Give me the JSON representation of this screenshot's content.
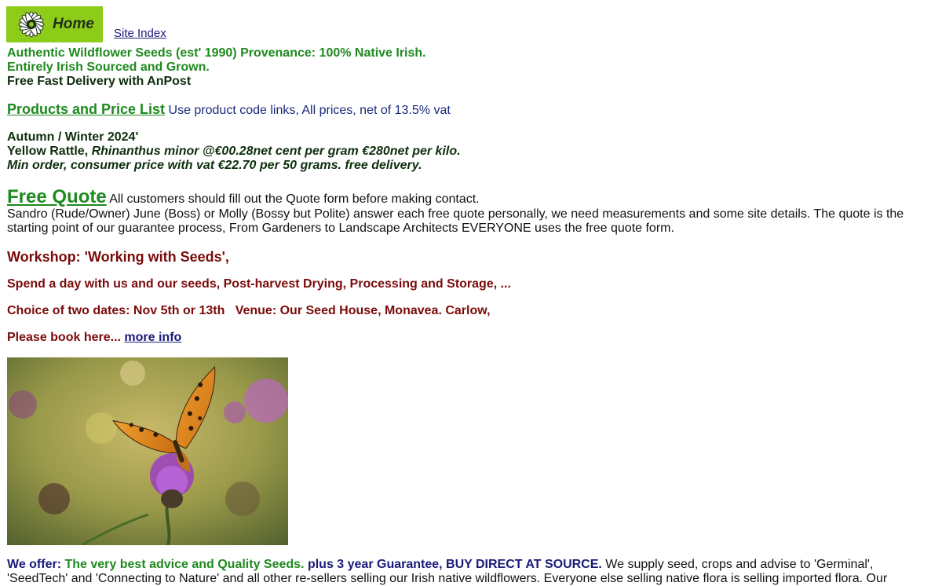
{
  "header": {
    "home_label": "Home",
    "site_index_label": "Site Index"
  },
  "intro": {
    "line1": "Authentic Wildflower Seeds (est' 1990) Provenance: 100% Native Irish.",
    "line2": "Entirely Irish Sourced and Grown.",
    "line3": "Free Fast Delivery with AnPost"
  },
  "products": {
    "link_label": "Products and Price List",
    "note": " Use product code links, All prices, net of 13.5% vat"
  },
  "offer_season": {
    "season": "Autumn / Winter 2024'",
    "item_name": "Yellow Rattle, ",
    "item_detail": "Rhinanthus minor @€00.28net cent per gram €280net per kilo.",
    "min_order": "Min order, consumer price with vat €22.70 per 50 grams. free delivery."
  },
  "quote": {
    "link_label": "Free Quote",
    "lead": " All customers should fill out the Quote form before making contact.",
    "paragraph": "Sandro (Rude/Owner) June (Boss) or Molly (Bossy but Polite) answer each free quote personally, we need measurements and some site details. The quote is the starting point of our guarantee process, From Gardeners to Landscape Architects EVERYONE uses the free quote form."
  },
  "workshop": {
    "title": "Workshop: 'Working with Seeds',",
    "line1": "Spend a day with us and our seeds, Post-harvest Drying, Processing and Storage, ...",
    "line2": "Choice of two dates: Nov 5th or 13th   Venue: Our Seed House, Monavea. Carlow,",
    "line3_text": "Please book here... ",
    "line3_link": "more info"
  },
  "offer": {
    "we_offer": "We offer: ",
    "advice": "The very best advice and Quality Seeds.",
    "guarantee": " plus 3 year Guarantee, BUY DIRECT AT SOURCE.",
    "rest": " We supply seed, crops and advise to 'Germinal', 'SeedTech' and 'Connecting to Nature' and all other re-sellers selling our Irish native wildflowers. Everyone else selling native flora is selling imported flora. Our"
  }
}
